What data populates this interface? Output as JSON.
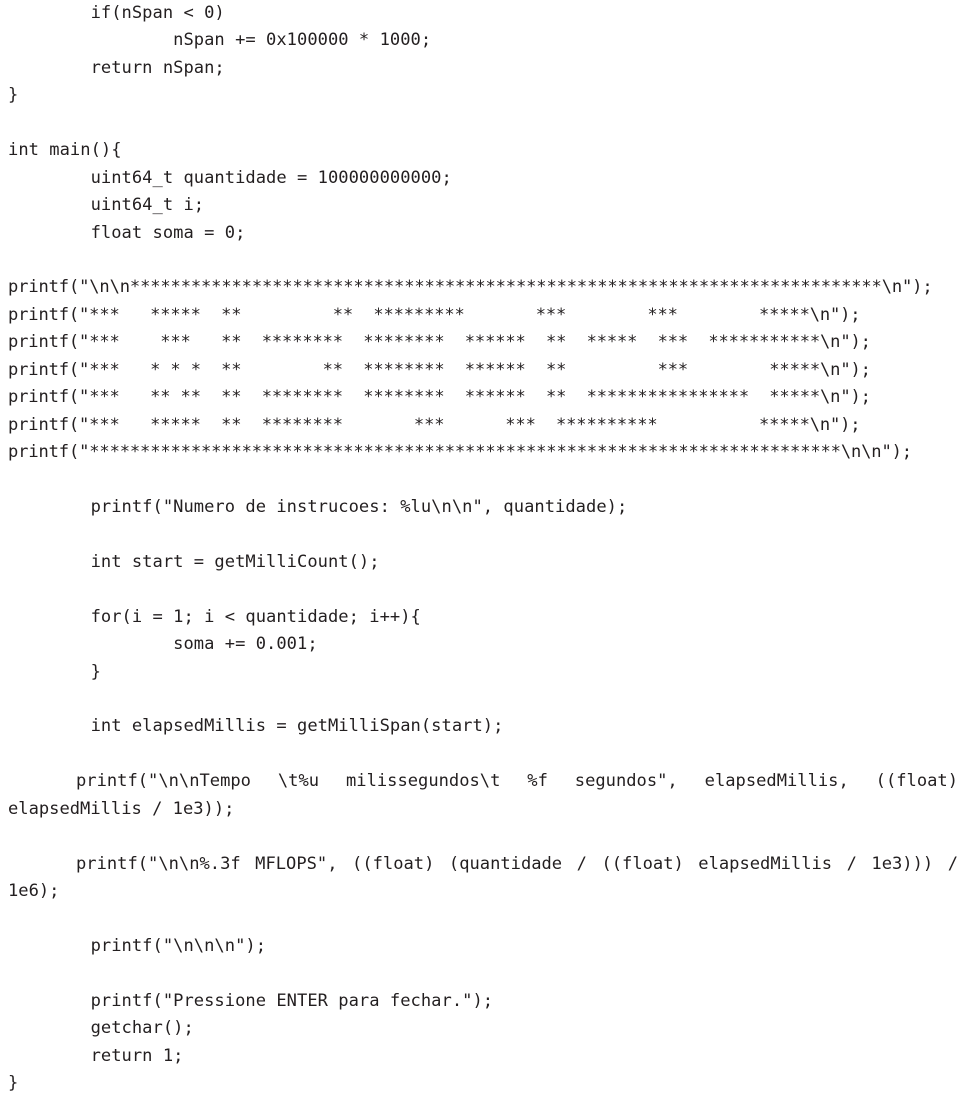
{
  "document": {
    "kind": "c-source-code-listing",
    "language": "C",
    "background_color": "#ffffff",
    "text_color": "#231f20"
  },
  "code": {
    "lines": [
      "        if(nSpan < 0)",
      "                nSpan += 0x100000 * 1000;",
      "        return nSpan;",
      "}",
      "",
      "int main(){",
      "        uint64_t quantidade = 100000000000;",
      "        uint64_t i;",
      "        float soma = 0;",
      ""
    ],
    "banner_lines": [
      "printf(\"\\n\\n**************************************************************************\\n\");",
      "printf(\"***   *****  **         **  *********       ***        ***        *****\\n\");",
      "printf(\"***    ***   **  ********  ********  ******  **  *****  ***  ***********\\n\");",
      "printf(\"***   * * *  **        **  ********  ******  **         ***        *****\\n\");",
      "printf(\"***   ** **  **  ********  ********  ******  **  ****************  *****\\n\");",
      "printf(\"***   *****  **  ********       ***      ***  **********          *****\\n\");",
      "printf(\"**************************************************************************\\n\\n\");"
    ],
    "banner_raw": [
      "printf(\"\\n\\n",
      "printf(\"***",
      "printf(\"***",
      "printf(\"***",
      "printf(\"***",
      "printf(\"***",
      "printf(\""
    ],
    "mid_lines": [
      "        printf(\"Numero de instrucoes: %lu\\n\\n\", quantidade);",
      "",
      "        int start = getMilliCount();",
      "",
      "        for(i = 1; i < quantidade; i++){",
      "                soma += 0.001;",
      "        }",
      "",
      "        int elapsedMillis = getMilliSpan(start);",
      ""
    ],
    "wrapped_statements": [
      "printf(\"\\n\\nTempo \\t%u milissegundos\\t %f segundos\", elapsedMillis, ((float) elapsedMillis / 1e3));",
      "printf(\"\\n\\n%.3f MFLOPS\", ((float) (quantidade / ((float) elapsedMillis / 1e3))) / 1e6);"
    ],
    "tail_lines": [
      "        printf(\"\\n\\n\\n\");",
      "",
      "        printf(\"Pressione ENTER para fechar.\");",
      "        getchar();",
      "        return 1;",
      "}"
    ]
  }
}
